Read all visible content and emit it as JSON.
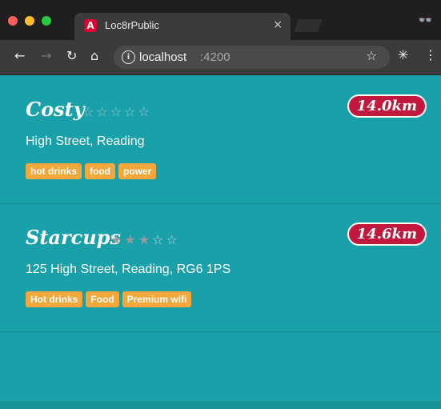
{
  "browser": {
    "tab": {
      "title": "Loc8rPublic",
      "favicon": "angular-icon",
      "favicon_letter": "A",
      "close_glyph": "×"
    },
    "profile_glyph": "👓",
    "nav": {
      "back_glyph": "←",
      "forward_glyph": "→",
      "reload_glyph": "↻",
      "home_glyph": "⌂"
    },
    "address": {
      "info_glyph": "i",
      "host": "localhost",
      "port": ":4200"
    },
    "actions": {
      "bookmark_glyph": "☆",
      "extension_glyph": "✳",
      "menu_glyph": "⋮"
    }
  },
  "locations": [
    {
      "name": "Costy",
      "rating": 0,
      "stars_empty": "☆☆☆☆☆",
      "distance": "14.0km",
      "address": "High Street, Reading",
      "tags": [
        "hot drinks",
        "food",
        "power"
      ]
    },
    {
      "name": "Starcups",
      "rating": 3,
      "stars_filled": "★★★",
      "stars_empty": "☆☆",
      "distance": "14.6km",
      "address": "125 High Street, Reading, RG6 1PS",
      "tags": [
        "Hot drinks",
        "Food",
        "Premium wifi"
      ]
    }
  ],
  "colors": {
    "background_teal": "#1aa0a8",
    "distance_badge": "#c2183d",
    "tag_background": "#f2a73a",
    "browser_dark": "#1f1f1f",
    "browser_toolbar": "#3b3b3b"
  }
}
